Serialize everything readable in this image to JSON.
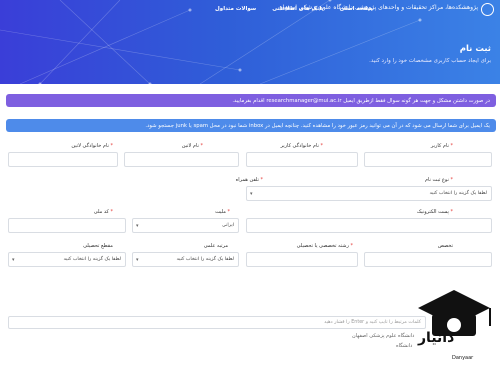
{
  "header": {
    "logo_text": "پژوهشکده‌ها، مراکز تحقیقات و واحدهای پژوهشی دانشگاه علوم پزشکی اصفهان",
    "nav": [
      "صفحه اصلی",
      "بانک های اطلاعاتی",
      "سوالات متداول"
    ],
    "title": "ثبت نام",
    "subtitle": "برای ایجاد حساب کاربری مشخصات خود را وارد کنید."
  },
  "alerts": {
    "purple": "در صورت داشتن مشکل و جهت هر گونه سوال فقط ازطریق ایمیل researchmanager@mui.ac.ir اقدام بفرمایید.",
    "blue": "یک ایمیل برای شما ارسال می شود که در آن می توانید رمز عبور خود را مشاهده کنید. چنانچه ایمیل در inbox شما نبود در محل spam یا junk جستجو شود."
  },
  "form": {
    "first_name": "نام کاربر",
    "last_name": "نام خانوادگی کاربر",
    "latin_name": "نام لاتین",
    "latin_last_name": "نام خانوادگی لاتین",
    "reg_type": "نوع ثبت نام",
    "reg_type_placeholder": "لطفا یک گزینه را انتخاب کنید",
    "mobile": "تلفن همراه",
    "email": "پست الکترونیک",
    "nationality": "ملیت",
    "nationality_value": "ایرانی",
    "national_code": "کد ملی",
    "specialty": "تخصص",
    "field_of_study": "رشته تخصصی یا تحصیلی",
    "academic_rank": "مرتبه علمی",
    "education": "مقطع تحصیلی",
    "select_placeholder": "لطفا یک گزینه را انتخاب کنید",
    "hint": "کلمات مرتبط را تایپ کنید و Enter را فشار دهید",
    "university_line1": "دانشگاه علوم پزشکی اصفهان",
    "university_line2": "دانشگاه"
  },
  "watermark": {
    "name": "دانیار",
    "latin": "Danyaar"
  }
}
